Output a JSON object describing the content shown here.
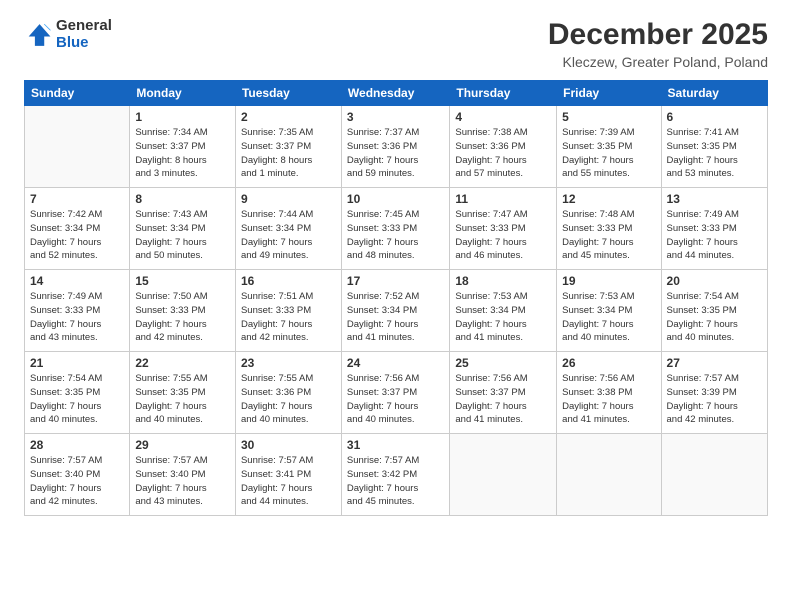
{
  "logo": {
    "line1": "General",
    "line2": "Blue"
  },
  "title": "December 2025",
  "location": "Kleczew, Greater Poland, Poland",
  "weekdays": [
    "Sunday",
    "Monday",
    "Tuesday",
    "Wednesday",
    "Thursday",
    "Friday",
    "Saturday"
  ],
  "weeks": [
    [
      {
        "day": "",
        "info": ""
      },
      {
        "day": "1",
        "info": "Sunrise: 7:34 AM\nSunset: 3:37 PM\nDaylight: 8 hours\nand 3 minutes."
      },
      {
        "day": "2",
        "info": "Sunrise: 7:35 AM\nSunset: 3:37 PM\nDaylight: 8 hours\nand 1 minute."
      },
      {
        "day": "3",
        "info": "Sunrise: 7:37 AM\nSunset: 3:36 PM\nDaylight: 7 hours\nand 59 minutes."
      },
      {
        "day": "4",
        "info": "Sunrise: 7:38 AM\nSunset: 3:36 PM\nDaylight: 7 hours\nand 57 minutes."
      },
      {
        "day": "5",
        "info": "Sunrise: 7:39 AM\nSunset: 3:35 PM\nDaylight: 7 hours\nand 55 minutes."
      },
      {
        "day": "6",
        "info": "Sunrise: 7:41 AM\nSunset: 3:35 PM\nDaylight: 7 hours\nand 53 minutes."
      }
    ],
    [
      {
        "day": "7",
        "info": "Sunrise: 7:42 AM\nSunset: 3:34 PM\nDaylight: 7 hours\nand 52 minutes."
      },
      {
        "day": "8",
        "info": "Sunrise: 7:43 AM\nSunset: 3:34 PM\nDaylight: 7 hours\nand 50 minutes."
      },
      {
        "day": "9",
        "info": "Sunrise: 7:44 AM\nSunset: 3:34 PM\nDaylight: 7 hours\nand 49 minutes."
      },
      {
        "day": "10",
        "info": "Sunrise: 7:45 AM\nSunset: 3:33 PM\nDaylight: 7 hours\nand 48 minutes."
      },
      {
        "day": "11",
        "info": "Sunrise: 7:47 AM\nSunset: 3:33 PM\nDaylight: 7 hours\nand 46 minutes."
      },
      {
        "day": "12",
        "info": "Sunrise: 7:48 AM\nSunset: 3:33 PM\nDaylight: 7 hours\nand 45 minutes."
      },
      {
        "day": "13",
        "info": "Sunrise: 7:49 AM\nSunset: 3:33 PM\nDaylight: 7 hours\nand 44 minutes."
      }
    ],
    [
      {
        "day": "14",
        "info": "Sunrise: 7:49 AM\nSunset: 3:33 PM\nDaylight: 7 hours\nand 43 minutes."
      },
      {
        "day": "15",
        "info": "Sunrise: 7:50 AM\nSunset: 3:33 PM\nDaylight: 7 hours\nand 42 minutes."
      },
      {
        "day": "16",
        "info": "Sunrise: 7:51 AM\nSunset: 3:33 PM\nDaylight: 7 hours\nand 42 minutes."
      },
      {
        "day": "17",
        "info": "Sunrise: 7:52 AM\nSunset: 3:34 PM\nDaylight: 7 hours\nand 41 minutes."
      },
      {
        "day": "18",
        "info": "Sunrise: 7:53 AM\nSunset: 3:34 PM\nDaylight: 7 hours\nand 41 minutes."
      },
      {
        "day": "19",
        "info": "Sunrise: 7:53 AM\nSunset: 3:34 PM\nDaylight: 7 hours\nand 40 minutes."
      },
      {
        "day": "20",
        "info": "Sunrise: 7:54 AM\nSunset: 3:35 PM\nDaylight: 7 hours\nand 40 minutes."
      }
    ],
    [
      {
        "day": "21",
        "info": "Sunrise: 7:54 AM\nSunset: 3:35 PM\nDaylight: 7 hours\nand 40 minutes."
      },
      {
        "day": "22",
        "info": "Sunrise: 7:55 AM\nSunset: 3:35 PM\nDaylight: 7 hours\nand 40 minutes."
      },
      {
        "day": "23",
        "info": "Sunrise: 7:55 AM\nSunset: 3:36 PM\nDaylight: 7 hours\nand 40 minutes."
      },
      {
        "day": "24",
        "info": "Sunrise: 7:56 AM\nSunset: 3:37 PM\nDaylight: 7 hours\nand 40 minutes."
      },
      {
        "day": "25",
        "info": "Sunrise: 7:56 AM\nSunset: 3:37 PM\nDaylight: 7 hours\nand 41 minutes."
      },
      {
        "day": "26",
        "info": "Sunrise: 7:56 AM\nSunset: 3:38 PM\nDaylight: 7 hours\nand 41 minutes."
      },
      {
        "day": "27",
        "info": "Sunrise: 7:57 AM\nSunset: 3:39 PM\nDaylight: 7 hours\nand 42 minutes."
      }
    ],
    [
      {
        "day": "28",
        "info": "Sunrise: 7:57 AM\nSunset: 3:40 PM\nDaylight: 7 hours\nand 42 minutes."
      },
      {
        "day": "29",
        "info": "Sunrise: 7:57 AM\nSunset: 3:40 PM\nDaylight: 7 hours\nand 43 minutes."
      },
      {
        "day": "30",
        "info": "Sunrise: 7:57 AM\nSunset: 3:41 PM\nDaylight: 7 hours\nand 44 minutes."
      },
      {
        "day": "31",
        "info": "Sunrise: 7:57 AM\nSunset: 3:42 PM\nDaylight: 7 hours\nand 45 minutes."
      },
      {
        "day": "",
        "info": ""
      },
      {
        "day": "",
        "info": ""
      },
      {
        "day": "",
        "info": ""
      }
    ]
  ]
}
